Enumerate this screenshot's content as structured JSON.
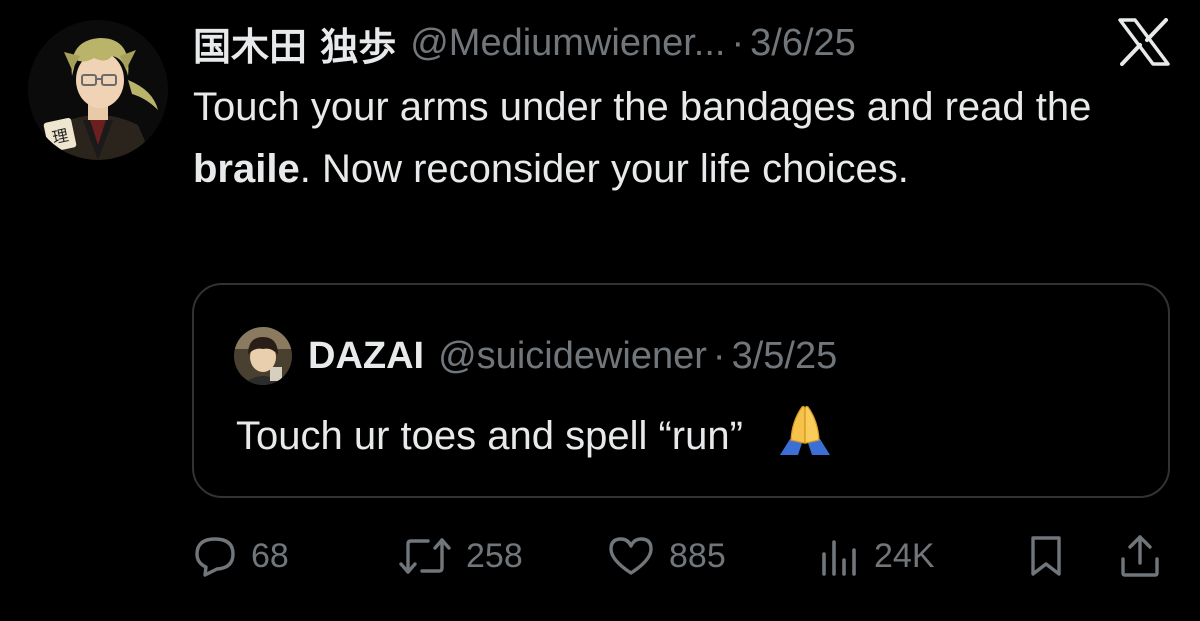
{
  "tweet": {
    "display_name": "国木田 独歩",
    "handle": "@Mediumwiener...",
    "separator": "·",
    "date": "3/6/25",
    "text_part1": "Touch your arms under the bandages and read the ",
    "text_bold": "braile",
    "text_part2": ". Now reconsider your life choices."
  },
  "quote": {
    "display_name": "DAZAI",
    "handle": "@suicidewiener",
    "separator": "·",
    "date": "3/5/25",
    "text": "Touch ur toes and spell “run”",
    "emoji": "folded-hands"
  },
  "actions": {
    "replies": "68",
    "retweets": "258",
    "likes": "885",
    "views": "24K"
  },
  "icons": {
    "close": "x-logo-icon",
    "reply": "reply-icon",
    "retweet": "retweet-icon",
    "like": "heart-icon",
    "views": "views-icon",
    "bookmark": "bookmark-icon",
    "share": "share-icon"
  },
  "colors": {
    "background": "#000000",
    "text": "#e7e9ea",
    "muted": "#71767b",
    "border": "#2f3336"
  }
}
